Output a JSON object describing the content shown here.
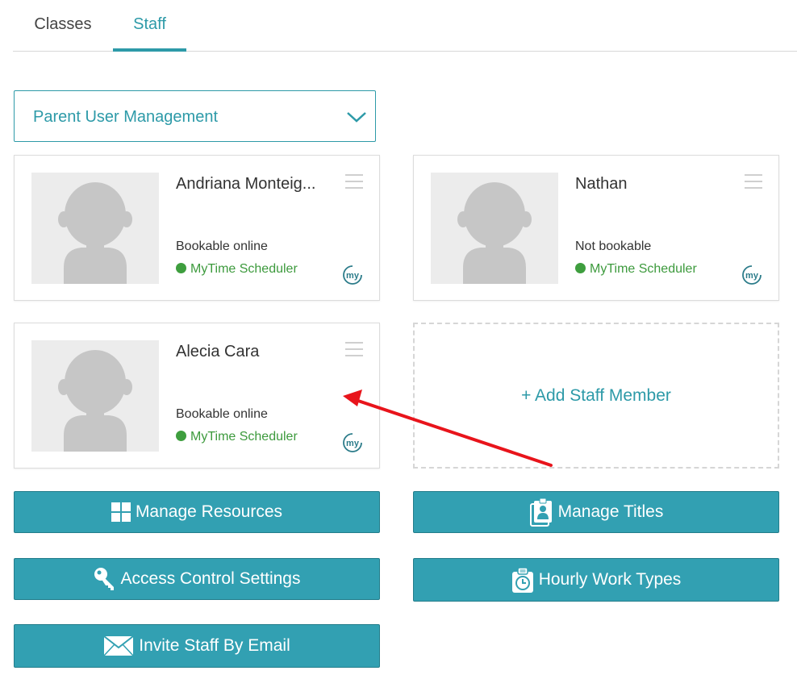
{
  "tabs": [
    {
      "label": "Classes",
      "active": false
    },
    {
      "label": "Staff",
      "active": true
    }
  ],
  "dropdown": {
    "selected": "Parent User Management"
  },
  "staff": [
    {
      "name": "Andriana Monteig...",
      "status": "Bookable online",
      "scheduler": "MyTime Scheduler"
    },
    {
      "name": "Nathan",
      "status": "Not bookable",
      "scheduler": "MyTime Scheduler"
    },
    {
      "name": "Alecia Cara",
      "status": "Bookable online",
      "scheduler": "MyTime Scheduler"
    }
  ],
  "add_staff": {
    "label": "+ Add Staff Member"
  },
  "buttons": {
    "manage_resources": "Manage Resources",
    "manage_titles": "Manage Titles",
    "access_control": "Access Control Settings",
    "hourly_work_types": "Hourly Work Types",
    "invite_email": "Invite Staff By Email"
  },
  "colors": {
    "accent": "#2d9aa8",
    "button": "#32a0b2",
    "online_dot": "#3e9e3e",
    "annotation_arrow": "#e8141b"
  },
  "icons": {
    "dropdown": "chevron-down-icon",
    "card_menu": "hamburger-icon",
    "scheduler": "mytime-logo-icon",
    "resources": "grid-icon",
    "titles": "id-badge-icon",
    "access": "key-icon",
    "hourly": "clock-clipboard-icon",
    "invite": "envelope-icon"
  }
}
